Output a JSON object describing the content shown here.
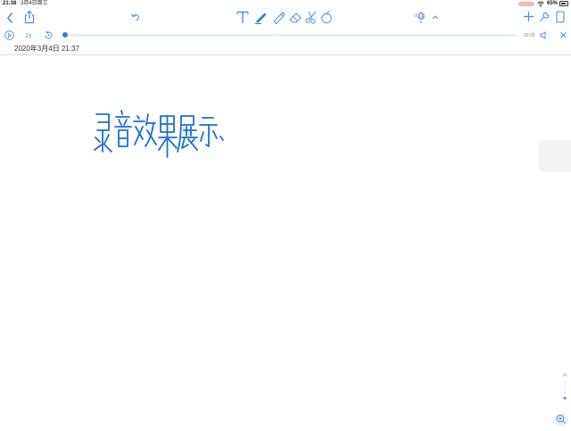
{
  "status_bar": {
    "time": "21:38",
    "date": "3月4日周三",
    "battery": "65%"
  },
  "toolbar": {
    "icons": [
      "back-icon",
      "share-icon",
      "undo-icon",
      "text-tool-icon",
      "pen-tool-icon",
      "highlighter-tool-icon",
      "eraser-tool-icon",
      "scissors-tool-icon",
      "shape-tool-icon",
      "microphone-icon",
      "chevron-up-icon",
      "add-icon",
      "settings-wrench-icon",
      "page-icon"
    ],
    "mic_time": "00:09",
    "accent_color": "#4a90e2"
  },
  "audio": {
    "speed": "1x",
    "time": "00:09",
    "progress": 0.0
  },
  "note": {
    "date": "2020年3月4日 21:37",
    "handwriting_text": "录音效果展示、",
    "ink_color": "#1a6fd6"
  }
}
